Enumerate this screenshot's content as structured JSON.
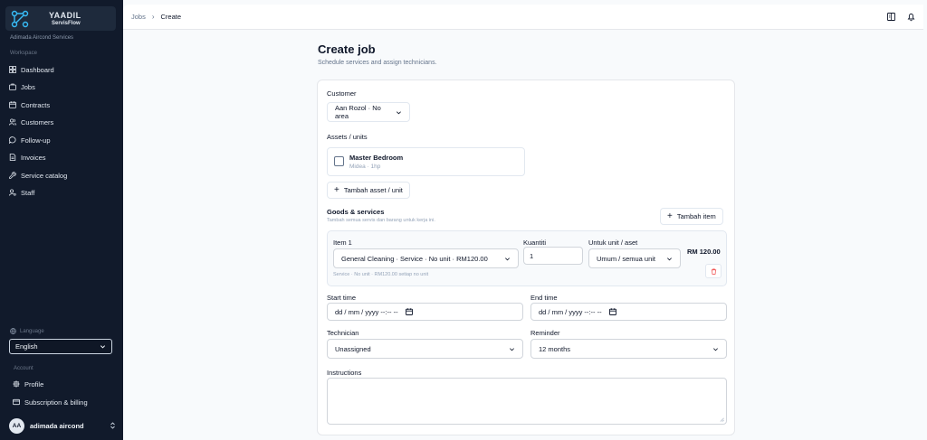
{
  "brand": {
    "name": "YAADIL",
    "sub": "ServisFlow",
    "company": "Adimada Aircond Services"
  },
  "sidebar": {
    "workspace_label": "Workspace",
    "items": [
      {
        "label": "Dashboard",
        "icon": "grid-icon"
      },
      {
        "label": "Jobs",
        "icon": "briefcase-icon"
      },
      {
        "label": "Contracts",
        "icon": "calendar-icon"
      },
      {
        "label": "Customers",
        "icon": "users-icon"
      },
      {
        "label": "Follow-up",
        "icon": "message-icon"
      },
      {
        "label": "Invoices",
        "icon": "file-icon"
      },
      {
        "label": "Service catalog",
        "icon": "wrench-icon"
      },
      {
        "label": "Staff",
        "icon": "user-cog-icon"
      }
    ],
    "language_label": "Language",
    "language_value": "English",
    "account_label": "Account",
    "account_items": [
      {
        "label": "Profile",
        "icon": "gear-icon"
      },
      {
        "label": "Subscription & billing",
        "icon": "card-icon"
      }
    ],
    "user": {
      "initials": "AA",
      "name": "adimada aircond"
    }
  },
  "topbar": {
    "crumb_root": "Jobs",
    "crumb_current": "Create"
  },
  "page": {
    "title": "Create job",
    "subtitle": "Schedule services and assign technicians."
  },
  "form": {
    "customer_label": "Customer",
    "customer_value": "Aan Rozol · No area",
    "assets_label": "Assets / units",
    "asset": {
      "name": "Master Bedroom",
      "meta": "Midea · 1hp"
    },
    "add_asset_label": "Tambah asset / unit",
    "goods_label": "Goods & services",
    "goods_hint": "Tambah semua servis dan barang untuk kerja ini.",
    "add_item_label": "Tambah item",
    "item": {
      "label": "Item 1",
      "service_value": "General Cleaning · Service · No unit · RM120.00",
      "qty_label": "Kuantiti",
      "qty_value": "1",
      "unit_label": "Untuk unit / aset",
      "unit_value": "Umum / semua unit",
      "price": "RM 120.00",
      "note": "Service · No unit · RM120.00 setiap no unit"
    },
    "start_label": "Start time",
    "start_value": "dd / mm / yyyy  --:--  --",
    "end_label": "End time",
    "end_value": "dd / mm / yyyy  --:--  --",
    "tech_label": "Technician",
    "tech_value": "Unassigned",
    "reminder_label": "Reminder",
    "reminder_value": "12 months",
    "instructions_label": "Instructions"
  }
}
